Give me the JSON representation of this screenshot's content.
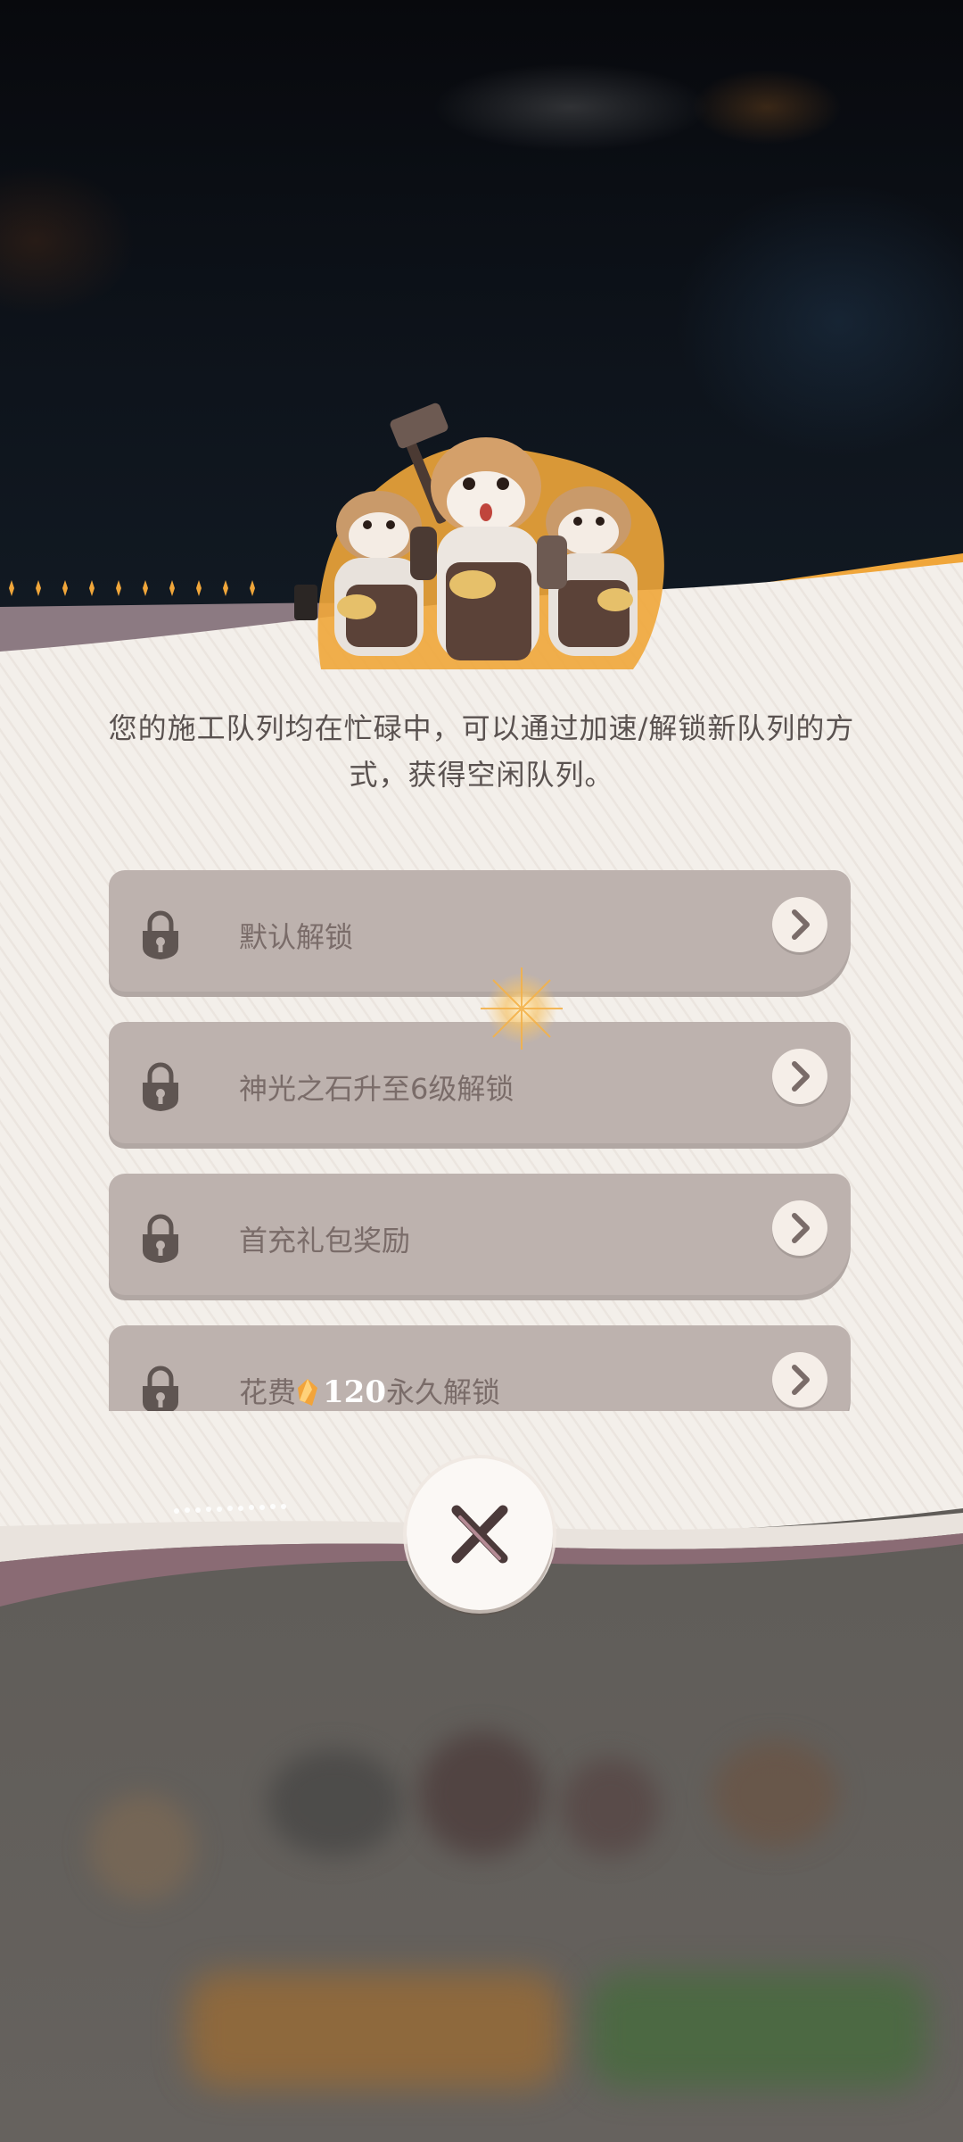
{
  "dialog": {
    "message": "您的施工队列均在忙碌中，可以通过加速/解锁新队列的方式，获得空闲队列。",
    "options": [
      {
        "label": "默认解锁"
      },
      {
        "label": "神光之石升至6级解锁"
      },
      {
        "label": "首充礼包奖励"
      },
      {
        "label_prefix": "花费",
        "amount": "120",
        "label_suffix": "永久解锁"
      }
    ],
    "close_icon": "close-icon"
  },
  "colors": {
    "panel": "#f3efea",
    "accent": "#f0a63a",
    "option_bg": "#bdb2ae",
    "bottom_band": "#8a6b74"
  }
}
